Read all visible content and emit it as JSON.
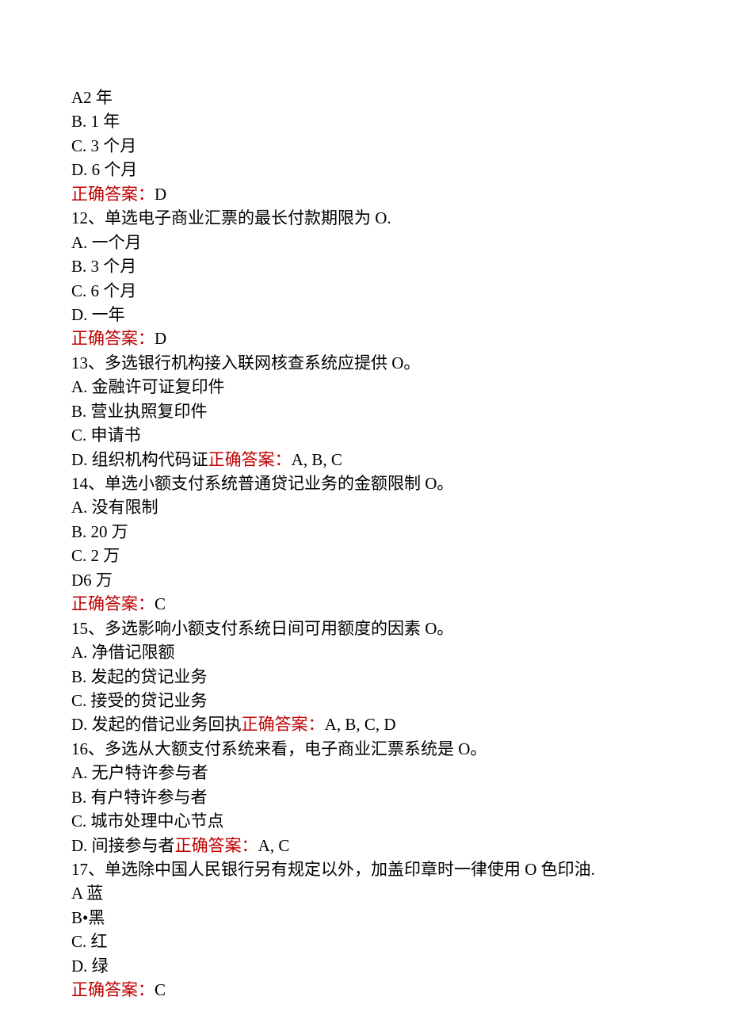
{
  "lines": [
    {
      "text": "A2 年"
    },
    {
      "text": "B. 1 年"
    },
    {
      "text": "C. 3 个月"
    },
    {
      "text": "D. 6 个月"
    },
    {
      "answerLabel": "正确答案：",
      "answerValue": "D"
    },
    {
      "text": "12、单选电子商业汇票的最长付款期限为 O."
    },
    {
      "text": "A. 一个月"
    },
    {
      "text": "B. 3 个月"
    },
    {
      "text": "C. 6 个月"
    },
    {
      "text": "D. 一年"
    },
    {
      "answerLabel": "正确答案：",
      "answerValue": "D"
    },
    {
      "text": "13、多选银行机构接入联网核查系统应提供 O。"
    },
    {
      "text": "A. 金融许可证复印件"
    },
    {
      "text": "B. 营业执照复印件"
    },
    {
      "text": "C. 申请书"
    },
    {
      "prefix": "D. 组织机构代码证",
      "answerLabel": "正确答案：",
      "answerValue": "A, B, C"
    },
    {
      "text": "14、单选小额支付系统普通贷记业务的金额限制 O。"
    },
    {
      "text": "A. 没有限制"
    },
    {
      "text": "B. 20 万"
    },
    {
      "text": "C. 2 万"
    },
    {
      "text": "D6 万"
    },
    {
      "answerLabel": "正确答案：",
      "answerValue": "C"
    },
    {
      "text": "15、多选影响小额支付系统日间可用额度的因素 O。"
    },
    {
      "text": "A. 净借记限额"
    },
    {
      "text": "B. 发起的贷记业务"
    },
    {
      "text": "C. 接受的贷记业务"
    },
    {
      "prefix": "D. 发起的借记业务回执",
      "answerLabel": "正确答案：",
      "answerValue": "A, B, C, D"
    },
    {
      "text": "16、多选从大额支付系统来看，电子商业汇票系统是 O。"
    },
    {
      "text": "A. 无户特许参与者"
    },
    {
      "text": "B. 有户特许参与者"
    },
    {
      "text": "C. 城市处理中心节点"
    },
    {
      "prefix": "D. 间接参与者",
      "answerLabel": "正确答案：",
      "answerValue": "A, C"
    },
    {
      "text": "17、单选除中国人民银行另有规定以外，加盖印章时一律使用 O 色印油."
    },
    {
      "text": "A 蓝"
    },
    {
      "text": "B•黑"
    },
    {
      "text": "C. 红"
    },
    {
      "text": "D. 绿"
    },
    {
      "answerLabel": "正确答案：",
      "answerValue": "C"
    }
  ]
}
